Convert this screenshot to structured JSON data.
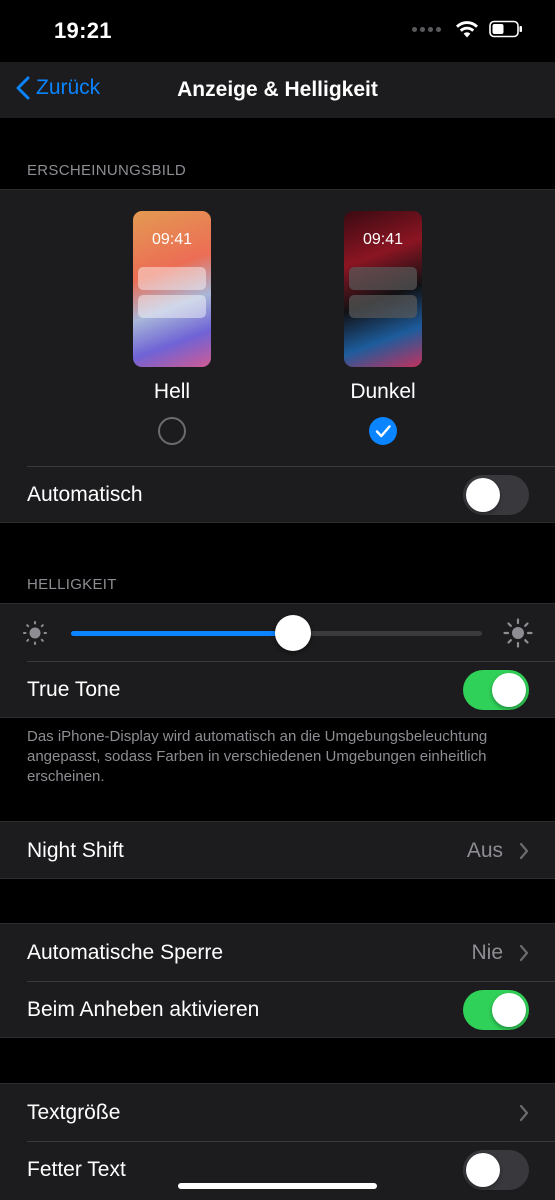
{
  "status_bar": {
    "time": "19:21"
  },
  "nav": {
    "back_label": "Zurück",
    "title": "Anzeige & Helligkeit"
  },
  "appearance": {
    "header": "ERSCHEINUNGSBILD",
    "light": {
      "preview_time": "09:41",
      "label": "Hell",
      "selected": false
    },
    "dark": {
      "preview_time": "09:41",
      "label": "Dunkel",
      "selected": true
    },
    "automatic_label": "Automatisch",
    "automatic_on": false
  },
  "brightness": {
    "header": "HELLIGKEIT",
    "level": 0.54,
    "true_tone_label": "True Tone",
    "true_tone_on": true,
    "footer": "Das iPhone-Display wird automatisch an die Umgebungsbeleuchtung angepasst, sodass Farben in verschiedenen Umgebungen einheitlich erscheinen."
  },
  "night_shift": {
    "label": "Night Shift",
    "value": "Aus"
  },
  "lock": {
    "auto_lock_label": "Automatische Sperre",
    "auto_lock_value": "Nie",
    "raise_to_wake_label": "Beim Anheben aktivieren",
    "raise_to_wake_on": true
  },
  "text": {
    "text_size_label": "Textgröße",
    "bold_text_label": "Fetter Text",
    "bold_text_on": false
  },
  "colors": {
    "accent": "#0a84ff",
    "toggle_on": "#30d158",
    "background": "#000000",
    "cell": "#1c1c1e"
  }
}
